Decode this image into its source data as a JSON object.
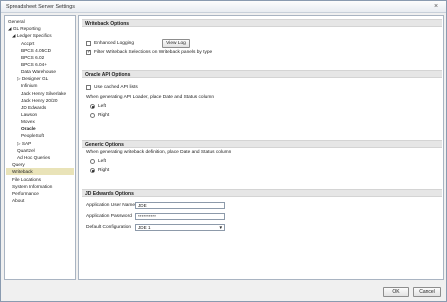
{
  "window": {
    "title": "Spreadsheet Server Settings",
    "close_glyph": "×"
  },
  "sidebar": {
    "items": [
      {
        "label": "General"
      },
      {
        "label": "◢ GL Reporting"
      },
      {
        "label": "◢ Ledger Specifics"
      },
      {
        "label": "Accprt"
      },
      {
        "label": "BPCS 4.05CD"
      },
      {
        "label": "BPCS 6.02"
      },
      {
        "label": "BPCS 6.04+"
      },
      {
        "label": "Data Warehouse"
      },
      {
        "label": "▷ Designer GL"
      },
      {
        "label": "Infinium"
      },
      {
        "label": "Jack Henry Silverlake"
      },
      {
        "label": "Jack Henry 20/20"
      },
      {
        "label": "JD Edwards"
      },
      {
        "label": "Lawson"
      },
      {
        "label": "Movex"
      },
      {
        "label": "Oracle"
      },
      {
        "label": "PeopleSoft"
      },
      {
        "label": "▷ SAP"
      },
      {
        "label": "Quartzel"
      },
      {
        "label": "Ad Hoc Queries"
      },
      {
        "label": "Query"
      },
      {
        "label": "Writeback"
      },
      {
        "label": "File Locations"
      },
      {
        "label": "System Information"
      },
      {
        "label": "Performance"
      },
      {
        "label": "About"
      }
    ]
  },
  "writeback": {
    "header": "Writeback Options",
    "enhanced_logging": "Enhanced Logging",
    "view_log": "View Log",
    "filter_label": "Filter Writeback Selections on Writeback panels by type"
  },
  "oracle_api": {
    "header": "Oracle API Options",
    "use_cached": "Use cached API lists",
    "prompt": "When generating API Loader, place Date and Status column",
    "left": "Left",
    "right": "Right"
  },
  "generic": {
    "header": "Generic Options",
    "prompt": "When generating writeback definition, place Date and Status column",
    "left": "Left",
    "right": "Right"
  },
  "jde": {
    "header": "JD Edwards Options",
    "user_label": "Application User Name",
    "user_value": "JDE",
    "password_label": "Application Password",
    "password_value": "**********",
    "config_label": "Default Configuration",
    "config_value": "JDE 1"
  },
  "footer": {
    "ok": "OK",
    "cancel": "Cancel"
  }
}
